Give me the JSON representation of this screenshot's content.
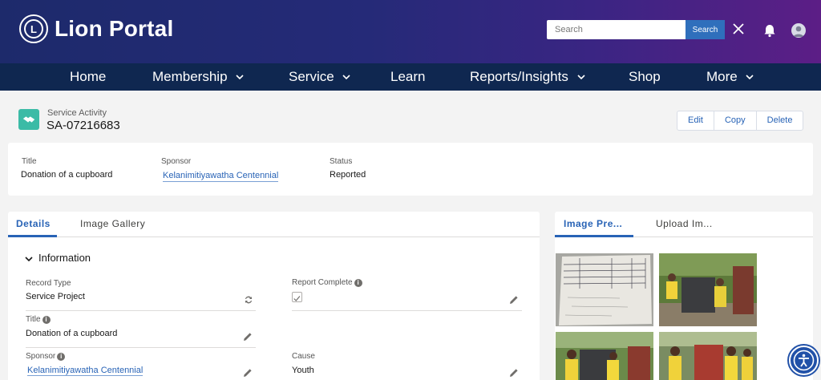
{
  "header": {
    "brand": "Lion Portal",
    "logo_text": "L",
    "search_placeholder": "Search",
    "search_button": "Search"
  },
  "nav": [
    {
      "label": "Home"
    },
    {
      "label": "Membership"
    },
    {
      "label": "Service"
    },
    {
      "label": "Learn"
    },
    {
      "label": "Reports/Insights"
    },
    {
      "label": "Shop"
    },
    {
      "label": "More"
    }
  ],
  "record": {
    "object_type": "Service Activity",
    "id": "SA-07216683",
    "actions": [
      "Edit",
      "Copy",
      "Delete"
    ]
  },
  "highlights": {
    "title_label": "Title",
    "title_value": "Donation of a cupboard",
    "sponsor_label": "Sponsor",
    "sponsor_value": "Kelanimitiyawatha Centennial",
    "status_label": "Status",
    "status_value": "Reported"
  },
  "left_tabs": [
    "Details",
    "Image Gallery"
  ],
  "right_tabs": [
    "Image Pre...",
    "Upload Im..."
  ],
  "details": {
    "section_title": "Information",
    "record_type_label": "Record Type",
    "record_type_value": "Service Project",
    "report_complete_label": "Report Complete",
    "report_complete_checked": true,
    "title_label": "Title",
    "title_value": "Donation of a cupboard",
    "sponsor_label": "Sponsor",
    "sponsor_value": "Kelanimitiyawatha Centennial",
    "cause_label": "Cause",
    "cause_value": "Youth"
  },
  "icons": {
    "logo": "lions-logo",
    "close": "close-icon",
    "bell": "bell-icon",
    "avatar": "avatar-icon",
    "record": "handshake-icon",
    "edit": "pencil-icon",
    "info": "info-icon",
    "accessibility": "accessibility-icon"
  },
  "colors": {
    "accent": "#2863b6",
    "nav_bg": "#0f2750",
    "record_icon": "#3bbba6"
  }
}
